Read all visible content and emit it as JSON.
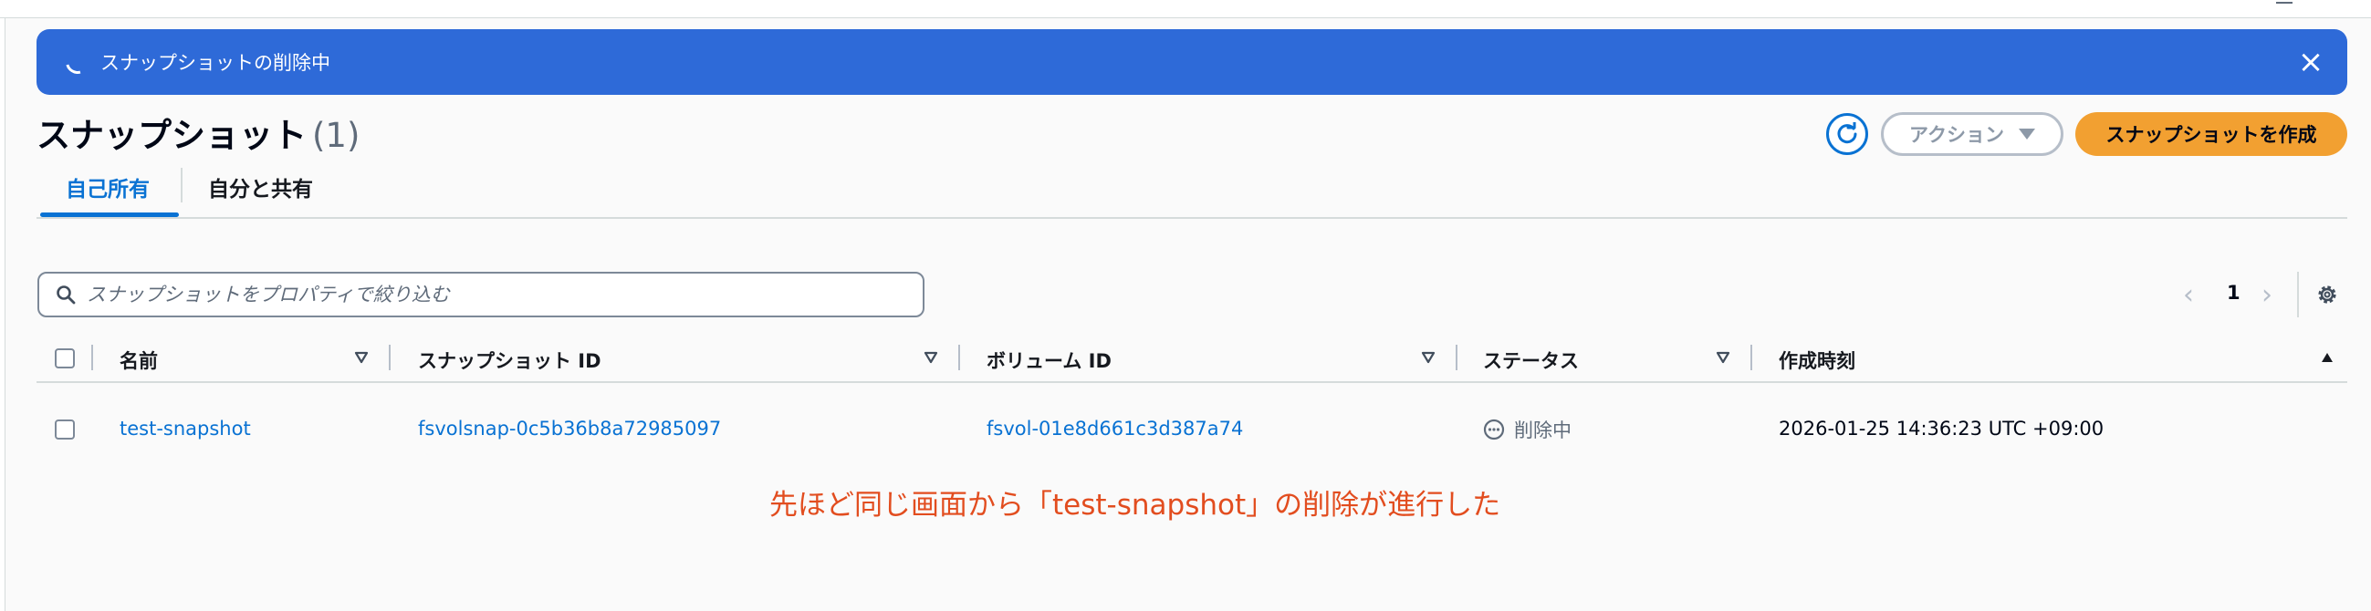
{
  "flash": {
    "message": "スナップショットの削除中",
    "close_label": "×"
  },
  "header": {
    "title": "スナップショット",
    "count": "(1)"
  },
  "toolbar": {
    "action_label": "アクション",
    "create_label": "スナップショットを作成"
  },
  "tabs": [
    {
      "label": "自己所有",
      "selected": true
    },
    {
      "label": "自分と共有",
      "selected": false
    }
  ],
  "filter": {
    "placeholder": "スナップショットをプロパティで絞り込む"
  },
  "pagination": {
    "current_page": "1",
    "prev_glyph": "‹",
    "next_glyph": "›"
  },
  "table": {
    "columns": [
      "名前",
      "スナップショット ID",
      "ボリューム ID",
      "ステータス",
      "作成時刻"
    ],
    "rows": [
      {
        "name": "test-snapshot",
        "snapshot_id": "fsvolsnap-0c5b36b8a72985097",
        "volume_id": "fsvol-01e8d661c3d387a74",
        "status": "削除中",
        "created": "2026-01-25 14:36:23 UTC +09:00"
      }
    ]
  },
  "annotation": {
    "text": "先ほど同じ画面から「test-snapshot」の削除が進行した"
  },
  "colors": {
    "flash_bg": "#2e6ad8",
    "primary_button": "#f2a031",
    "link": "#0972d3",
    "annotation": "#e24d1f"
  },
  "icons": [
    "spinner-icon",
    "close-icon",
    "refresh-icon",
    "caret-down-icon",
    "search-icon",
    "chevron-left-icon",
    "chevron-right-icon",
    "settings-icon",
    "sort-down-icon",
    "sort-up-icon",
    "status-in-progress-icon"
  ]
}
